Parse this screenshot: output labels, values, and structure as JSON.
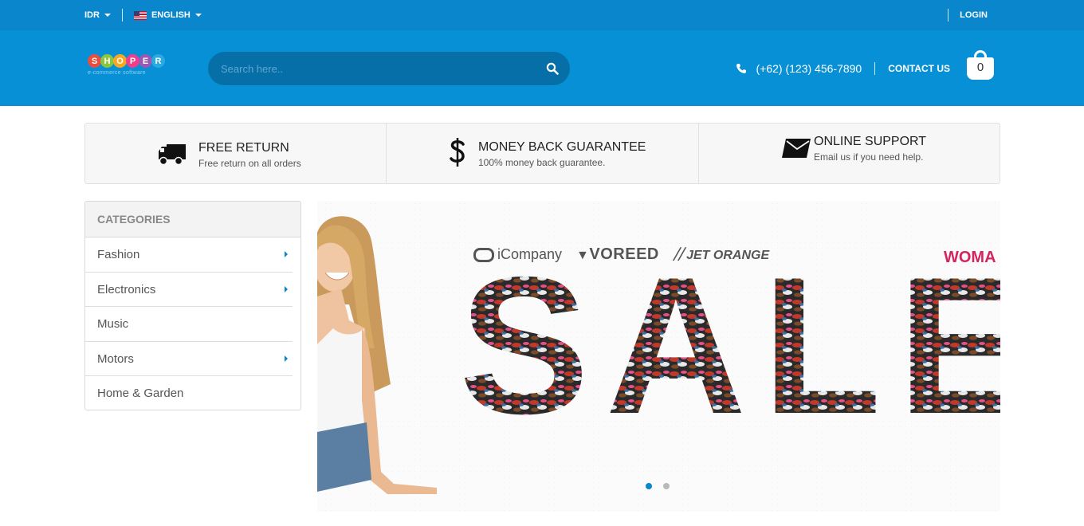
{
  "topbar": {
    "currency": "IDR",
    "language": "ENGLISH",
    "login": "LOGIN"
  },
  "header": {
    "logo_letters": [
      "S",
      "H",
      "O",
      "P",
      "E",
      "R"
    ],
    "logo_tagline": "e-commerce software",
    "search_placeholder": "Search here..",
    "phone": "(+62) (123) 456-7890",
    "contact_label": "CONTACT US",
    "cart_count": "0"
  },
  "features": [
    {
      "title": "FREE RETURN",
      "subtitle": "Free return on all orders",
      "icon": "truck-icon"
    },
    {
      "title": "MONEY BACK GUARANTEE",
      "subtitle": "100% money back guarantee.",
      "icon": "dollar-icon"
    },
    {
      "title": "ONLINE SUPPORT",
      "subtitle": "Email us if you need help.",
      "icon": "envelope-icon"
    }
  ],
  "categories": {
    "heading": "CATEGORIES",
    "items": [
      {
        "label": "Fashion",
        "has_submenu": true
      },
      {
        "label": "Electronics",
        "has_submenu": true
      },
      {
        "label": "Music",
        "has_submenu": false
      },
      {
        "label": "Motors",
        "has_submenu": true
      },
      {
        "label": "Home & Garden",
        "has_submenu": false
      }
    ]
  },
  "banner": {
    "brands": [
      "iCompany",
      "VOREED",
      "JET ORANGE"
    ],
    "corner_text": "WOMA",
    "headline": "SALE",
    "slides": 2,
    "active_slide": 1
  },
  "colors": {
    "topbar": "#0a86cc",
    "header": "#0790d5",
    "search": "#066fa8",
    "accent": "#0a86cc",
    "women_pink": "#d4245e"
  }
}
